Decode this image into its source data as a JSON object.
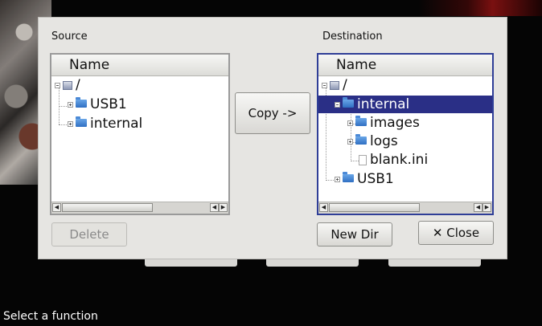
{
  "source": {
    "label": "Source",
    "header": "Name",
    "tree": [
      {
        "name": "/",
        "icon": "drive-icon"
      },
      {
        "name": "USB1",
        "icon": "folder-icon"
      },
      {
        "name": "internal",
        "icon": "folder-icon"
      }
    ]
  },
  "destination": {
    "label": "Destination",
    "header": "Name",
    "tree": [
      {
        "name": "/",
        "icon": "drive-icon"
      },
      {
        "name": "internal",
        "icon": "folder-icon",
        "selected": true
      },
      {
        "name": "images",
        "icon": "folder-icon"
      },
      {
        "name": "logs",
        "icon": "folder-icon"
      },
      {
        "name": "blank.ini",
        "icon": "file-icon"
      },
      {
        "name": "USB1",
        "icon": "folder-icon"
      }
    ]
  },
  "buttons": {
    "copy": "Copy ->",
    "delete": "Delete",
    "new_dir": "New Dir",
    "close": "✕ Close"
  },
  "status_bar": "Select a function",
  "colors": {
    "selection": "#2a2f86",
    "active_border": "#2f3e97",
    "dialog_bg": "#e6e5e2"
  }
}
